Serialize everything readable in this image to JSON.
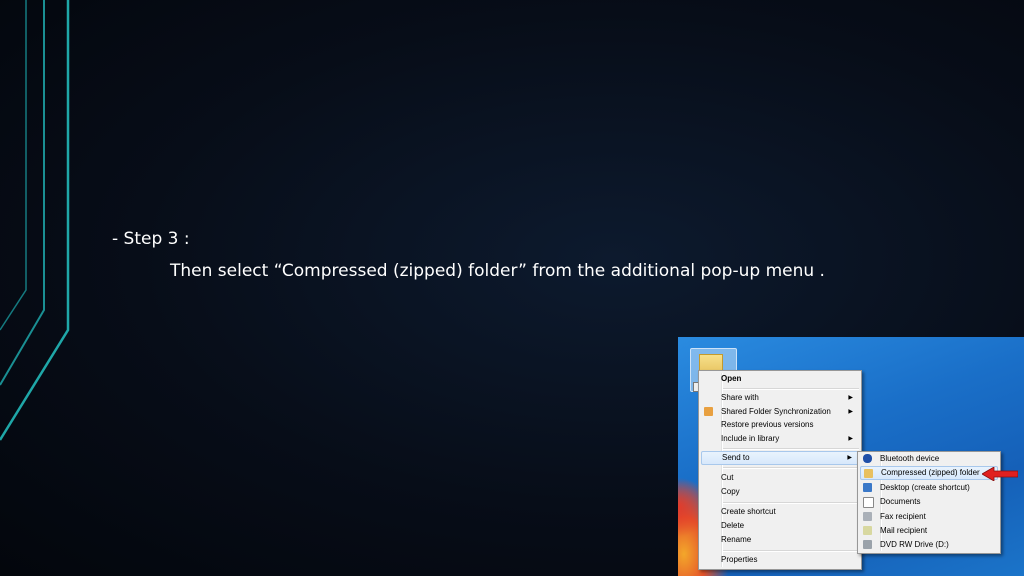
{
  "slide": {
    "step_line": "-  Step 3 :",
    "step_description": "Then select “Compressed (zipped) folder” from the additional pop-up menu ."
  },
  "context_menu": {
    "open": "Open",
    "share_with": "Share with",
    "shared_folder_sync": "Shared Folder Synchronization",
    "restore_previous": "Restore previous versions",
    "include_in_library": "Include in library",
    "send_to": "Send to",
    "cut": "Cut",
    "copy": "Copy",
    "create_shortcut": "Create shortcut",
    "delete": "Delete",
    "rename": "Rename",
    "properties": "Properties"
  },
  "send_to_menu": {
    "bluetooth": "Bluetooth device",
    "compressed": "Compressed (zipped) folder",
    "desktop": "Desktop (create shortcut)",
    "documents": "Documents",
    "fax": "Fax recipient",
    "mail": "Mail recipient",
    "dvd": "DVD RW Drive (D:)"
  },
  "colors": {
    "background": "#070d18",
    "accent_lines": "#1fa7a8",
    "text": "#ffffff",
    "arrow": "#e02020",
    "highlight": "#d7e8fb"
  },
  "icons": [
    "folder-icon",
    "bluetooth-icon",
    "zip-folder-icon",
    "desktop-icon",
    "documents-icon",
    "fax-icon",
    "mail-icon",
    "dvd-drive-icon",
    "red-arrow-icon"
  ]
}
